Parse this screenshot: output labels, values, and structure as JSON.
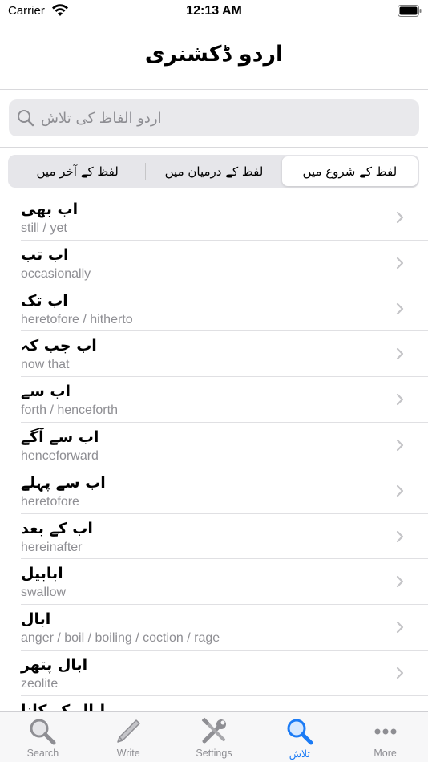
{
  "status_bar": {
    "carrier": "Carrier",
    "time": "12:13 AM"
  },
  "nav": {
    "title": "اردو ڈکشنری"
  },
  "search": {
    "placeholder": "اردو الفاظ کی تلاش",
    "value": ""
  },
  "segments": [
    {
      "label": "لفظ کے آخر میں",
      "selected": false
    },
    {
      "label": "لفظ کے درمیان میں",
      "selected": false
    },
    {
      "label": "لفظ کے شروع میں",
      "selected": true
    }
  ],
  "entries": [
    {
      "word": "اب بھی",
      "meaning": "still / yet"
    },
    {
      "word": "اب تب",
      "meaning": "occasionally"
    },
    {
      "word": "اب تک",
      "meaning": "heretofore / hitherto"
    },
    {
      "word": "اب جب کہ",
      "meaning": "now that"
    },
    {
      "word": "اب سے",
      "meaning": "forth / henceforth"
    },
    {
      "word": "اب سے آگے",
      "meaning": "henceforward"
    },
    {
      "word": "اب سے پہلے",
      "meaning": "heretofore"
    },
    {
      "word": "اب کے بعد",
      "meaning": "hereinafter"
    },
    {
      "word": "ابابیل",
      "meaning": "swallow"
    },
    {
      "word": "ابال",
      "meaning": "anger / boil / boiling / coction / rage"
    },
    {
      "word": "ابال پتھر",
      "meaning": "zeolite"
    },
    {
      "word": "ابال کے کانا",
      "meaning": ""
    }
  ],
  "tabs": [
    {
      "label": "Search",
      "icon": "magnifier-icon",
      "active": false
    },
    {
      "label": "Write",
      "icon": "pen-icon",
      "active": false
    },
    {
      "label": "Settings",
      "icon": "tools-icon",
      "active": false
    },
    {
      "label": "تلاش",
      "icon": "search-blue-icon",
      "active": true
    },
    {
      "label": "More",
      "icon": "more-dots-icon",
      "active": false
    }
  ],
  "colors": {
    "accent": "#1b7bf5",
    "secondary_text": "#8e8e93",
    "separator": "#e0e0e3"
  }
}
